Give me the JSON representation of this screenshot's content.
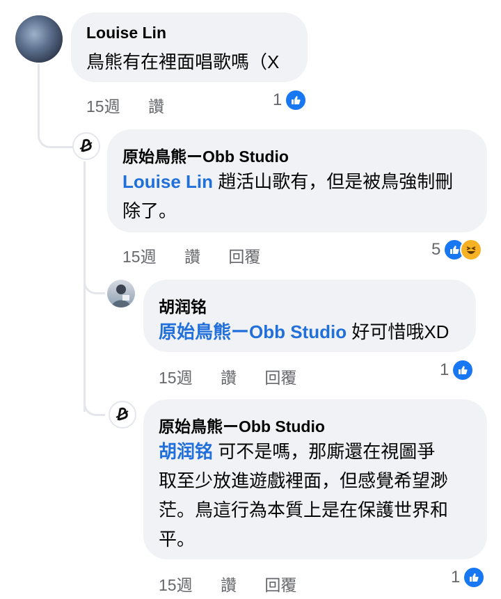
{
  "comments": [
    {
      "author": "Louise Lin",
      "text": "鳥熊有在裡面唱歌嗎（X",
      "time": "15週",
      "like": "讚",
      "reactions": "1",
      "avatar_icon": "photo-avatar-icon"
    },
    {
      "author": "原始鳥熊ーObb Studio",
      "mention": "Louise Lin",
      "text_line1": " 趙活山歌有，但是被鳥強制刪",
      "text_line2": "除了。",
      "time": "15週",
      "like": "讚",
      "reply": "回覆",
      "reactions": "5",
      "avatar_icon": "obb-logo-icon"
    },
    {
      "author": "胡润铭",
      "mention": "原始鳥熊ーObb Studio",
      "text": " 好可惜哦XD",
      "time": "15週",
      "like": "讚",
      "reply": "回覆",
      "reactions": "1",
      "avatar_icon": "photo-avatar-icon"
    },
    {
      "author": "原始鳥熊ーObb Studio",
      "mention": "胡润铭",
      "text_line1": " 可不是嗎，那廝還在視圖爭",
      "text_line2": "取至少放進遊戲裡面，但感覺希望渺",
      "text_line3": "茫。鳥這行為本質上是在保護世界和",
      "text_line4": "平。",
      "time": "15週",
      "like": "讚",
      "reply": "回覆",
      "reactions": "1",
      "avatar_icon": "obb-logo-icon"
    }
  ],
  "colors": {
    "bubble": "#f0f2f5",
    "mention": "#216fdb",
    "meta": "#65676b",
    "like": "#1877f2",
    "haha": "#f7b125"
  }
}
